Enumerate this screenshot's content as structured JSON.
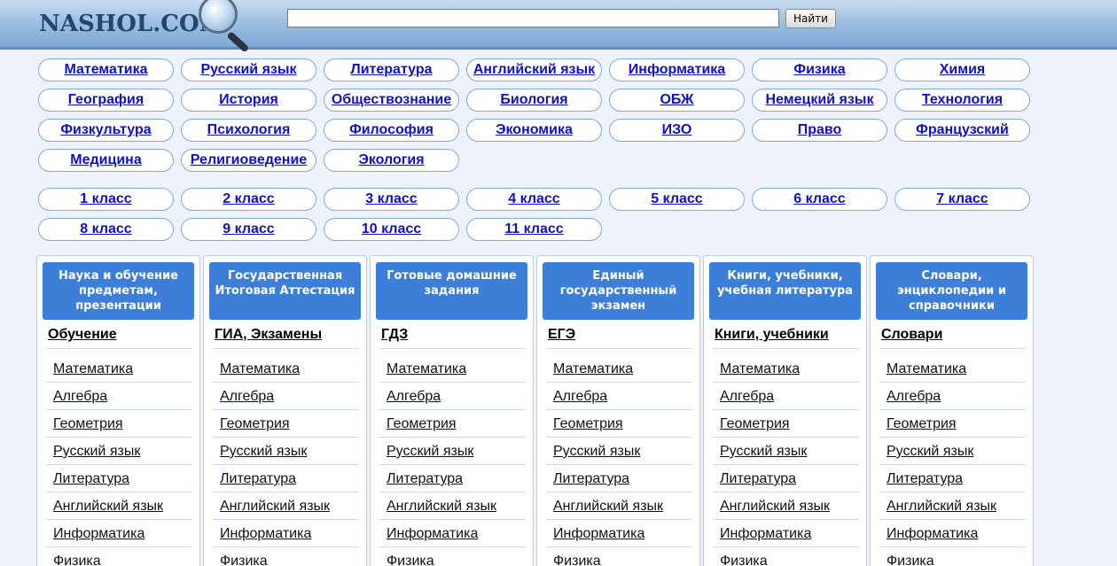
{
  "header": {
    "logo_text": "NASHOL.COM",
    "search_value": "",
    "search_button": "Найти"
  },
  "subjects": [
    "Математика",
    "Русский язык",
    "Литература",
    "Английский язык",
    "Информатика",
    "Физика",
    "Химия",
    "География",
    "История",
    "Обществознание",
    "Биология",
    "ОБЖ",
    "Немецкий язык",
    "Технология",
    "Физкультура",
    "Психология",
    "Философия",
    "Экономика",
    "ИЗО",
    "Право",
    "Французский",
    "Медицина",
    "Религиоведение",
    "Экология"
  ],
  "grades": [
    "1 класс",
    "2 класс",
    "3 класс",
    "4 класс",
    "5 класс",
    "6 класс",
    "7 класс",
    "8 класс",
    "9 класс",
    "10 класс",
    "11 класс"
  ],
  "columns": [
    {
      "header": "Наука и обучение предметам, презентации",
      "title": "Обучение",
      "items": [
        "Математика",
        "Алгебра",
        "Геометрия",
        "Русский язык",
        "Литература",
        "Английский язык",
        "Информатика",
        "Физика"
      ]
    },
    {
      "header": "Государственная Итоговая Аттестация",
      "title": "ГИА, Экзамены",
      "items": [
        "Математика",
        "Алгебра",
        "Геометрия",
        "Русский язык",
        "Литература",
        "Английский язык",
        "Информатика",
        "Физика"
      ]
    },
    {
      "header": "Готовые домашние задания",
      "title": "ГДЗ",
      "items": [
        "Математика",
        "Алгебра",
        "Геометрия",
        "Русский язык",
        "Литература",
        "Английский язык",
        "Информатика",
        "Физика"
      ]
    },
    {
      "header": "Единый государственный экзамен",
      "title": "ЕГЭ",
      "items": [
        "Математика",
        "Алгебра",
        "Геометрия",
        "Русский язык",
        "Литература",
        "Английский язык",
        "Информатика",
        "Физика"
      ]
    },
    {
      "header": "Книги, учебники, учебная литература",
      "title": "Книги, учебники",
      "items": [
        "Математика",
        "Алгебра",
        "Геометрия",
        "Русский язык",
        "Литература",
        "Английский язык",
        "Информатика",
        "Физика"
      ]
    },
    {
      "header": "Словари, энциклопедии и справочники",
      "title": "Словари",
      "items": [
        "Математика",
        "Алгебра",
        "Геометрия",
        "Русский язык",
        "Литература",
        "Английский язык",
        "Информатика",
        "Физика"
      ]
    }
  ]
}
